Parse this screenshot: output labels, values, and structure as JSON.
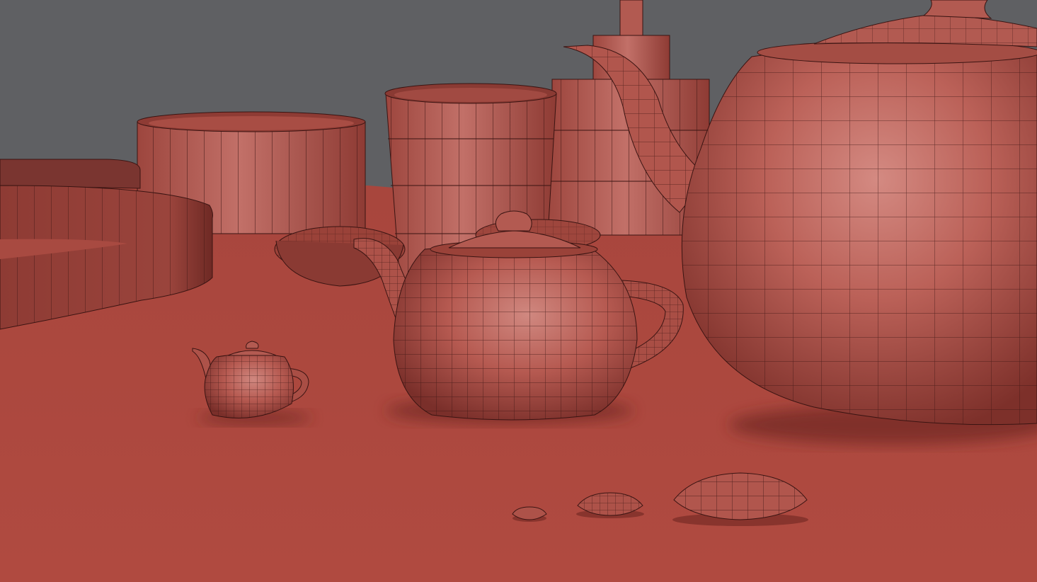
{
  "scene": {
    "colors": {
      "background": "#5f6063",
      "floor": "#b04a40",
      "clay": "#b5574d",
      "clay_light": "#c98077",
      "clay_dark": "#7a2f2a",
      "wire": "#3a1412"
    },
    "objects": [
      "large-cylinder-ring",
      "left-cylinder-cup",
      "tall-tapered-cup",
      "stacked-cylinder-tower",
      "saucer-left",
      "saucer-right",
      "teapot-large",
      "teapot-medium",
      "teapot-small",
      "lid-small",
      "lid-medium",
      "lid-large"
    ]
  }
}
